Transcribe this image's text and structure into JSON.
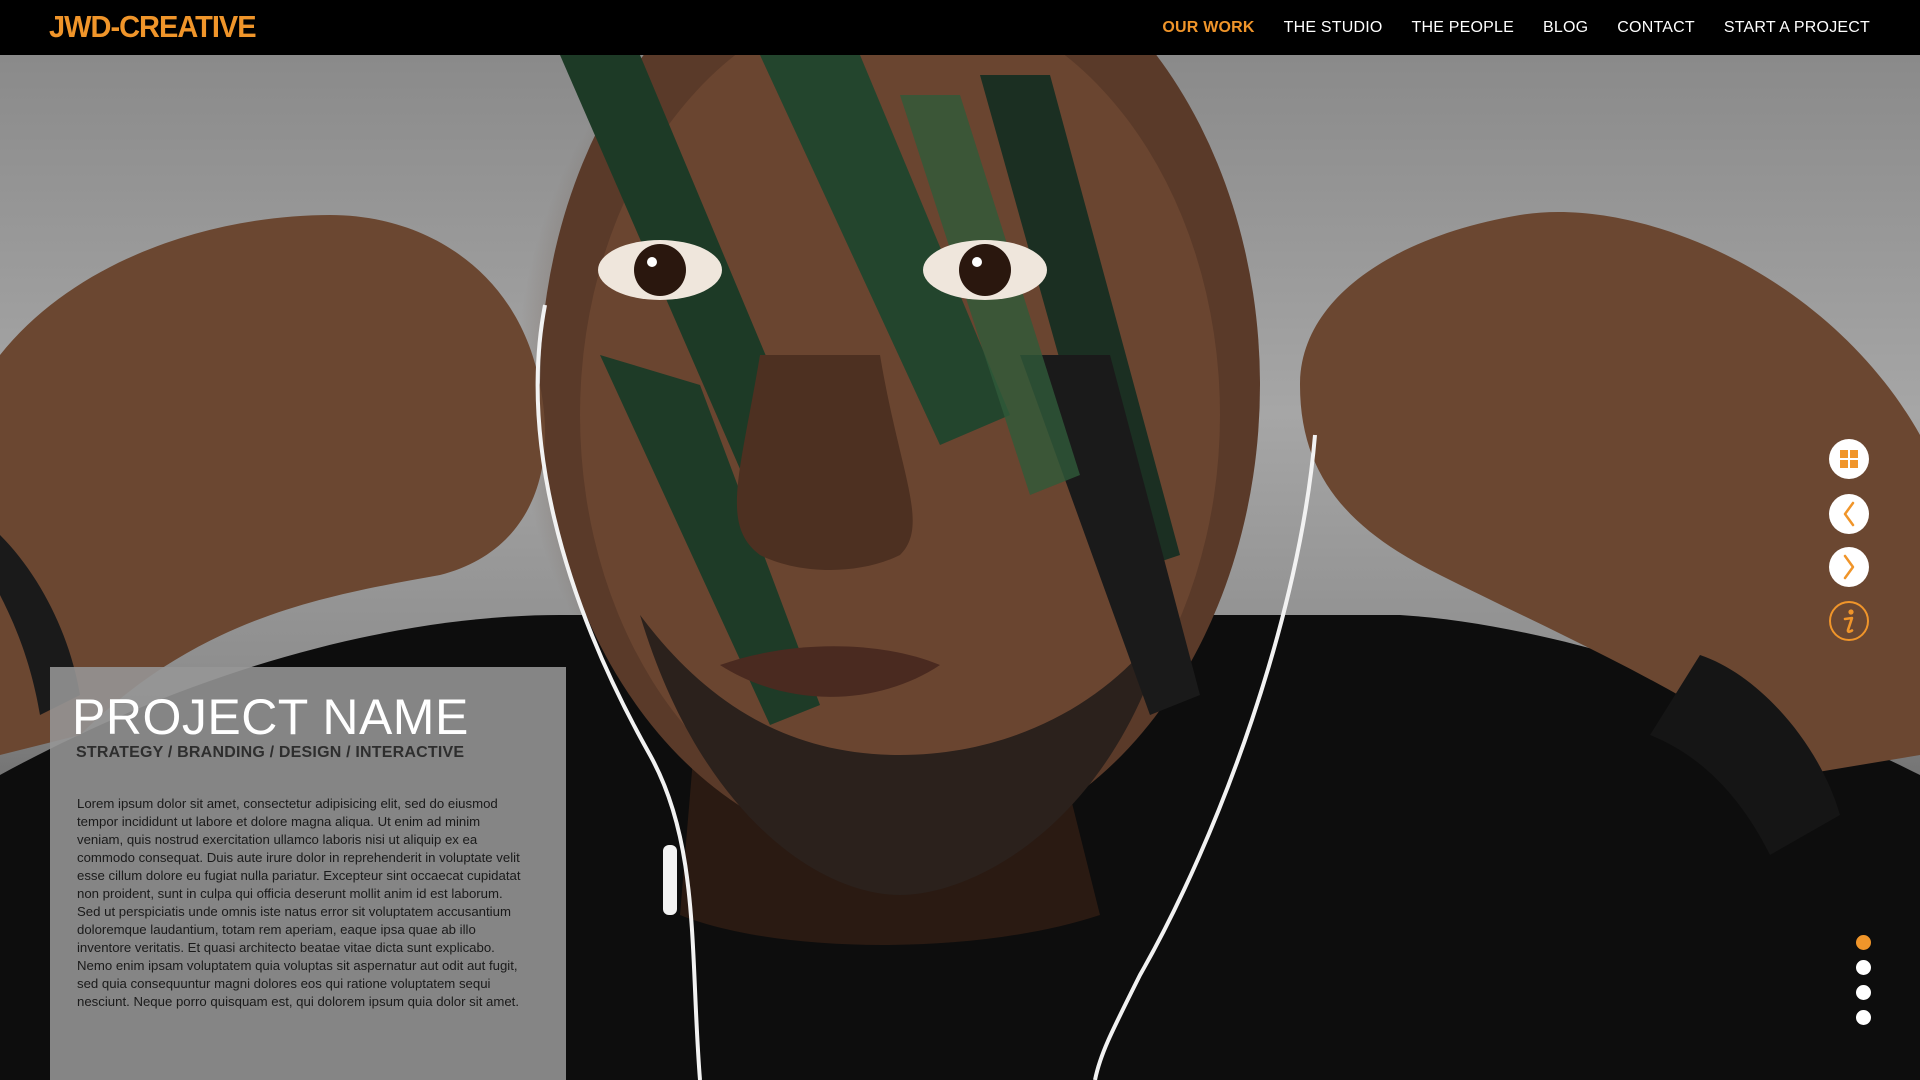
{
  "header": {
    "logo_text": "JWD-CREATIVE",
    "nav": [
      {
        "label": "OUR WORK",
        "active": true
      },
      {
        "label": "THE STUDIO",
        "active": false
      },
      {
        "label": "THE PEOPLE",
        "active": false
      },
      {
        "label": "BLOG",
        "active": false
      },
      {
        "label": "CONTACT",
        "active": false
      },
      {
        "label": "START A PROJECT",
        "active": false
      }
    ]
  },
  "project": {
    "title": "PROJECT NAME",
    "subtitle": "STRATEGY / BRANDING / DESIGN / INTERACTIVE",
    "body": "Lorem ipsum dolor sit amet, consectetur adipisicing elit, sed do eiusmod tempor incididunt ut labore et dolore magna aliqua. Ut enim ad minim veniam, quis nostrud exercitation ullamco laboris nisi ut aliquip ex ea commodo consequat. Duis aute irure dolor in reprehenderit in voluptate velit esse cillum dolore eu fugiat nulla pariatur. Excepteur sint occaecat cupidatat non proident, sunt in culpa qui officia deserunt mollit anim id est laborum. Sed ut perspiciatis unde omnis iste natus error sit voluptatem accusantium doloremque laudantium, totam rem aperiam, eaque ipsa quae ab illo inventore veritatis. Et quasi architecto beatae vitae dicta sunt explicabo. Nemo enim ipsam voluptatem quia voluptas sit aspernatur aut odit aut fugit, sed quia consequuntur magni dolores eos qui ratione voluptatem sequi nesciunt. Neque porro quisquam est, qui dolorem ipsum quia dolor sit amet."
  },
  "controls": {
    "grid_icon": "grid-icon",
    "prev_icon": "chevron-left-icon",
    "next_icon": "chevron-right-icon",
    "info_icon": "info-icon"
  },
  "pagination": {
    "total": 4,
    "current": 1
  },
  "colors": {
    "accent": "#f0952a",
    "header_bg": "#000000",
    "panel_bg": "#969696"
  }
}
